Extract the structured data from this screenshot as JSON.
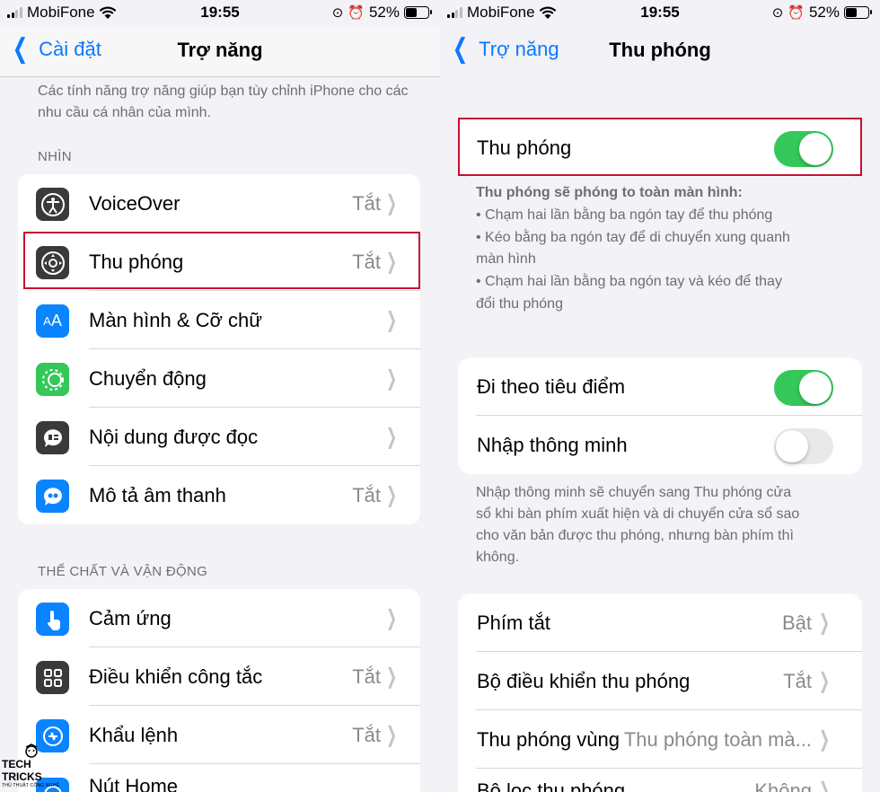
{
  "colors": {
    "accent": "#0a7aff",
    "toggle_on": "#34c759",
    "highlight": "#c8102e"
  },
  "left": {
    "status": {
      "carrier": "MobiFone",
      "time": "19:55",
      "battery": "52%"
    },
    "nav": {
      "back": "Cài đặt",
      "title": "Trợ năng"
    },
    "description": "Các tính năng trợ năng giúp bạn tùy chỉnh iPhone cho các nhu cầu cá nhân của mình.",
    "section_vision": {
      "header": "NHÌN",
      "items": [
        {
          "label": "VoiceOver",
          "value": "Tắt",
          "icon": "voiceover-icon",
          "color": "#3a3a3c"
        },
        {
          "label": "Thu phóng",
          "value": "Tắt",
          "icon": "zoom-icon",
          "color": "#3a3a3c"
        },
        {
          "label": "Màn hình & Cỡ chữ",
          "value": "",
          "icon": "text-size-icon",
          "color": "#0a84ff"
        },
        {
          "label": "Chuyển động",
          "value": "",
          "icon": "motion-icon",
          "color": "#34c759"
        },
        {
          "label": "Nội dung được đọc",
          "value": "",
          "icon": "spoken-content-icon",
          "color": "#3a3a3c"
        },
        {
          "label": "Mô tả âm thanh",
          "value": "Tắt",
          "icon": "audio-description-icon",
          "color": "#0a84ff"
        }
      ]
    },
    "section_physical": {
      "header": "THỂ CHẤT VÀ VẬN ĐỘNG",
      "items": [
        {
          "label": "Cảm ứng",
          "value": "",
          "icon": "touch-icon",
          "color": "#0a84ff"
        },
        {
          "label": "Điều khiển công tắc",
          "value": "Tắt",
          "icon": "switch-control-icon",
          "color": "#3a3a3c"
        },
        {
          "label": "Khẩu lệnh",
          "value": "Tắt",
          "icon": "voice-control-icon",
          "color": "#0a84ff"
        },
        {
          "label": "Nút Home",
          "value": "",
          "icon": "home-button-icon",
          "color": "#0a84ff"
        }
      ]
    },
    "watermark": {
      "title": "TECH TRICKS",
      "subtitle": "THỦ THUẬT CÔNG NGHỆ"
    }
  },
  "right": {
    "status": {
      "carrier": "MobiFone",
      "time": "19:55",
      "battery": "52%"
    },
    "nav": {
      "back": "Trợ năng",
      "title": "Thu phóng"
    },
    "zoom_toggle": {
      "label": "Thu phóng",
      "on": true
    },
    "zoom_desc": {
      "title": "Thu phóng sẽ phóng to toàn màn hình:",
      "line1": "•  Chạm hai lần bằng ba ngón tay để thu phóng",
      "line2": "•  Kéo bằng ba ngón tay để di chuyển xung quanh",
      "line2b": "màn hình",
      "line3": "•  Chạm hai lần bằng ba ngón tay và kéo để thay",
      "line3b": "đổi thu phóng"
    },
    "follow_focus": {
      "label": "Đi theo tiêu điểm",
      "on": true
    },
    "smart_typing": {
      "label": "Nhập thông minh",
      "on": false
    },
    "smart_desc": {
      "line1": "Nhập thông minh sẽ chuyển sang Thu phóng cửa",
      "line2": "sổ khi bàn phím xuất hiện và di chuyển cửa sổ sao",
      "line3": "cho văn bản được thu phóng, nhưng bàn phím thì",
      "line4": "không."
    },
    "settings": [
      {
        "label": "Phím tắt",
        "value": "Bật"
      },
      {
        "label": "Bộ điều khiển thu phóng",
        "value": "Tắt"
      },
      {
        "label": "Thu phóng vùng",
        "value": "Thu phóng toàn mà..."
      },
      {
        "label": "Bộ lọc thu phóng",
        "value": "Không"
      }
    ]
  }
}
